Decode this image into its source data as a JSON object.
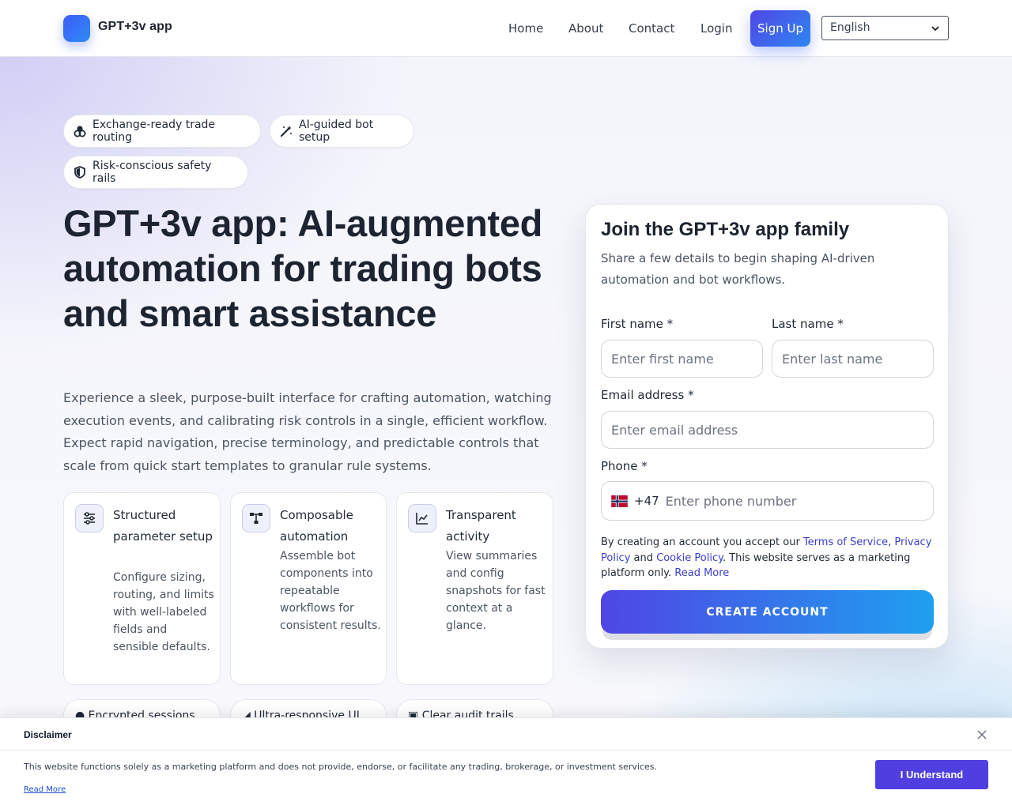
{
  "header": {
    "logo_text": "GPT+3v app",
    "nav": [
      "Home",
      "About",
      "Contact",
      "Login"
    ],
    "signup_label": "Sign Up",
    "language": "English"
  },
  "chips": [
    {
      "label": "Exchange-ready trade routing",
      "icon": "coins-icon"
    },
    {
      "label": "AI-guided bot setup",
      "icon": "magic-wand-icon"
    },
    {
      "label": "Risk-conscious safety rails",
      "icon": "shield-icon"
    }
  ],
  "hero": {
    "title": "GPT+3v app: AI-augmented automation for trading bots and smart assistance",
    "description": "Experience a sleek, purpose-built interface for crafting automation, watching execution events, and calibrating risk controls in a single, efficient workflow. Expect rapid navigation, precise terminology, and predictable controls that scale from quick start templates to granular rule systems."
  },
  "features": [
    {
      "title": "Structured parameter setup",
      "body": "Configure sizing, routing, and limits with well-labeled fields and sensible defaults.",
      "icon": "sliders-icon"
    },
    {
      "title": "Composable automation",
      "body": "Assemble bot components into repeatable workflows for consistent results.",
      "icon": "workflow-icon"
    },
    {
      "title": "Transparent activity",
      "body": "View summaries and config snapshots for fast context at a glance.",
      "icon": "chart-line-icon"
    }
  ],
  "pills": [
    {
      "label": "Encrypted sessions",
      "icon": "lock-icon"
    },
    {
      "label": "Ultra-responsive UI",
      "icon": "bolt-icon"
    },
    {
      "label": "Clear audit trails",
      "icon": "clipboard-icon"
    }
  ],
  "form": {
    "title": "Join the GPT+3v app family",
    "subtitle": "Share a few details to begin shaping AI-driven automation and bot workflows.",
    "first_name_label": "First name *",
    "first_name_placeholder": "Enter first name",
    "last_name_label": "Last name *",
    "last_name_placeholder": "Enter last name",
    "email_label": "Email address *",
    "email_placeholder": "Enter email address",
    "phone_label": "Phone *",
    "phone_prefix": "+47",
    "phone_placeholder": "Enter phone number",
    "terms_prefix": "By creating an account you accept our ",
    "terms_link": "Terms of Service",
    "terms_sep": ", ",
    "privacy_link": "Privacy Policy",
    "terms_and": " and ",
    "cookie_link": "Cookie Policy",
    "terms_suffix": ". This website serves as a marketing platform only. ",
    "read_more": "Read More",
    "submit_label": "CREATE ACCOUNT"
  },
  "disclaimer": {
    "title": "Disclaimer",
    "text": "This website functions solely as a marketing platform and does not provide, endorse, or facilitate any trading, brokerage, or investment services.",
    "read_more": "Read More",
    "button": "I Understand"
  }
}
